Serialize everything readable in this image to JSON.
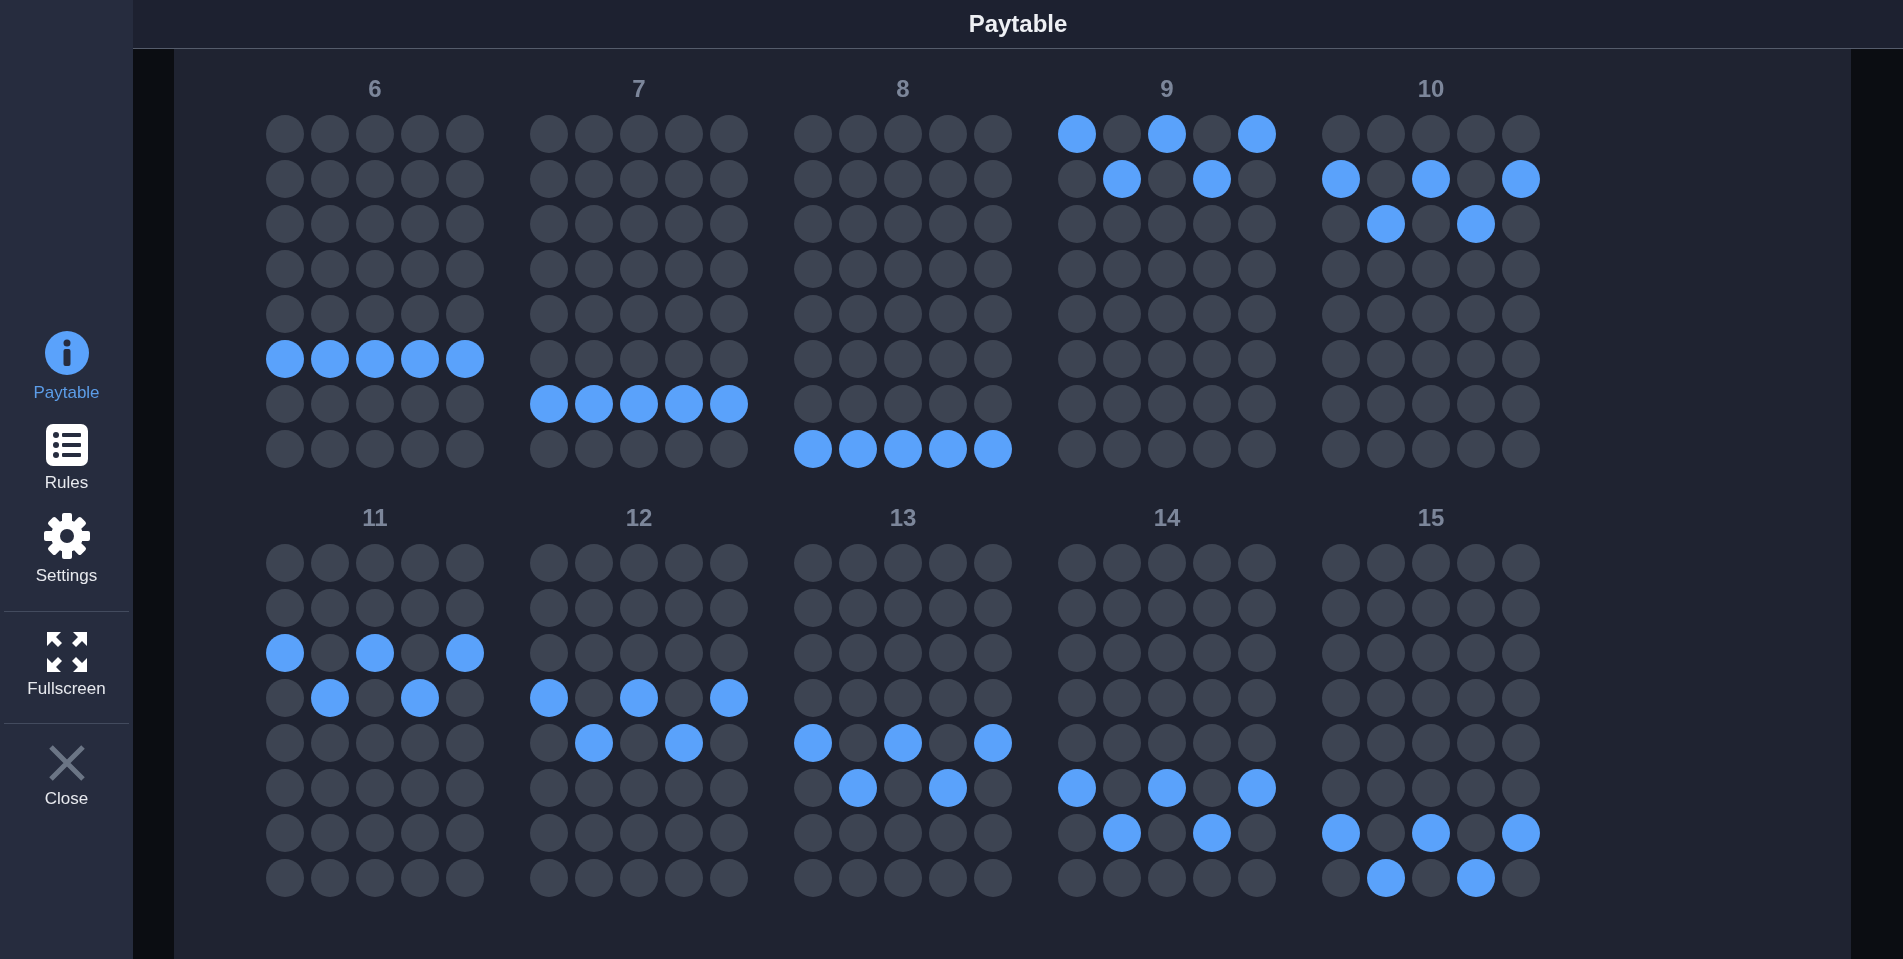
{
  "header": {
    "title": "Paytable"
  },
  "sidebar": {
    "groups": [
      {
        "items": [
          {
            "kind": "info",
            "label": "Paytable",
            "selected": true
          },
          {
            "kind": "list",
            "label": "Rules",
            "selected": false
          },
          {
            "kind": "gear",
            "label": "Settings",
            "selected": false
          }
        ]
      },
      {
        "items": [
          {
            "kind": "expand",
            "label": "Fullscreen",
            "selected": false
          }
        ]
      },
      {
        "items": [
          {
            "kind": "close",
            "label": "Close",
            "selected": false
          }
        ]
      }
    ]
  },
  "paylines": [
    {
      "number": "6",
      "grid": [
        [
          false,
          false,
          false,
          false,
          false
        ],
        [
          false,
          false,
          false,
          false,
          false
        ],
        [
          false,
          false,
          false,
          false,
          false
        ],
        [
          false,
          false,
          false,
          false,
          false
        ],
        [
          false,
          false,
          false,
          false,
          false
        ],
        [
          true,
          true,
          true,
          true,
          true
        ],
        [
          false,
          false,
          false,
          false,
          false
        ],
        [
          false,
          false,
          false,
          false,
          false
        ]
      ]
    },
    {
      "number": "7",
      "grid": [
        [
          false,
          false,
          false,
          false,
          false
        ],
        [
          false,
          false,
          false,
          false,
          false
        ],
        [
          false,
          false,
          false,
          false,
          false
        ],
        [
          false,
          false,
          false,
          false,
          false
        ],
        [
          false,
          false,
          false,
          false,
          false
        ],
        [
          false,
          false,
          false,
          false,
          false
        ],
        [
          true,
          true,
          true,
          true,
          true
        ],
        [
          false,
          false,
          false,
          false,
          false
        ]
      ]
    },
    {
      "number": "8",
      "grid": [
        [
          false,
          false,
          false,
          false,
          false
        ],
        [
          false,
          false,
          false,
          false,
          false
        ],
        [
          false,
          false,
          false,
          false,
          false
        ],
        [
          false,
          false,
          false,
          false,
          false
        ],
        [
          false,
          false,
          false,
          false,
          false
        ],
        [
          false,
          false,
          false,
          false,
          false
        ],
        [
          false,
          false,
          false,
          false,
          false
        ],
        [
          true,
          true,
          true,
          true,
          true
        ]
      ]
    },
    {
      "number": "9",
      "grid": [
        [
          true,
          false,
          true,
          false,
          true
        ],
        [
          false,
          true,
          false,
          true,
          false
        ],
        [
          false,
          false,
          false,
          false,
          false
        ],
        [
          false,
          false,
          false,
          false,
          false
        ],
        [
          false,
          false,
          false,
          false,
          false
        ],
        [
          false,
          false,
          false,
          false,
          false
        ],
        [
          false,
          false,
          false,
          false,
          false
        ],
        [
          false,
          false,
          false,
          false,
          false
        ]
      ]
    },
    {
      "number": "10",
      "grid": [
        [
          false,
          false,
          false,
          false,
          false
        ],
        [
          true,
          false,
          true,
          false,
          true
        ],
        [
          false,
          true,
          false,
          true,
          false
        ],
        [
          false,
          false,
          false,
          false,
          false
        ],
        [
          false,
          false,
          false,
          false,
          false
        ],
        [
          false,
          false,
          false,
          false,
          false
        ],
        [
          false,
          false,
          false,
          false,
          false
        ],
        [
          false,
          false,
          false,
          false,
          false
        ]
      ]
    },
    {
      "number": "11",
      "grid": [
        [
          false,
          false,
          false,
          false,
          false
        ],
        [
          false,
          false,
          false,
          false,
          false
        ],
        [
          true,
          false,
          true,
          false,
          true
        ],
        [
          false,
          true,
          false,
          true,
          false
        ],
        [
          false,
          false,
          false,
          false,
          false
        ],
        [
          false,
          false,
          false,
          false,
          false
        ],
        [
          false,
          false,
          false,
          false,
          false
        ],
        [
          false,
          false,
          false,
          false,
          false
        ]
      ]
    },
    {
      "number": "12",
      "grid": [
        [
          false,
          false,
          false,
          false,
          false
        ],
        [
          false,
          false,
          false,
          false,
          false
        ],
        [
          false,
          false,
          false,
          false,
          false
        ],
        [
          true,
          false,
          true,
          false,
          true
        ],
        [
          false,
          true,
          false,
          true,
          false
        ],
        [
          false,
          false,
          false,
          false,
          false
        ],
        [
          false,
          false,
          false,
          false,
          false
        ],
        [
          false,
          false,
          false,
          false,
          false
        ]
      ]
    },
    {
      "number": "13",
      "grid": [
        [
          false,
          false,
          false,
          false,
          false
        ],
        [
          false,
          false,
          false,
          false,
          false
        ],
        [
          false,
          false,
          false,
          false,
          false
        ],
        [
          false,
          false,
          false,
          false,
          false
        ],
        [
          true,
          false,
          true,
          false,
          true
        ],
        [
          false,
          true,
          false,
          true,
          false
        ],
        [
          false,
          false,
          false,
          false,
          false
        ],
        [
          false,
          false,
          false,
          false,
          false
        ]
      ]
    },
    {
      "number": "14",
      "grid": [
        [
          false,
          false,
          false,
          false,
          false
        ],
        [
          false,
          false,
          false,
          false,
          false
        ],
        [
          false,
          false,
          false,
          false,
          false
        ],
        [
          false,
          false,
          false,
          false,
          false
        ],
        [
          false,
          false,
          false,
          false,
          false
        ],
        [
          true,
          false,
          true,
          false,
          true
        ],
        [
          false,
          true,
          false,
          true,
          false
        ],
        [
          false,
          false,
          false,
          false,
          false
        ]
      ]
    },
    {
      "number": "15",
      "grid": [
        [
          false,
          false,
          false,
          false,
          false
        ],
        [
          false,
          false,
          false,
          false,
          false
        ],
        [
          false,
          false,
          false,
          false,
          false
        ],
        [
          false,
          false,
          false,
          false,
          false
        ],
        [
          false,
          false,
          false,
          false,
          false
        ],
        [
          false,
          false,
          false,
          false,
          false
        ],
        [
          true,
          false,
          true,
          false,
          true
        ],
        [
          false,
          true,
          false,
          true,
          false
        ]
      ]
    }
  ]
}
